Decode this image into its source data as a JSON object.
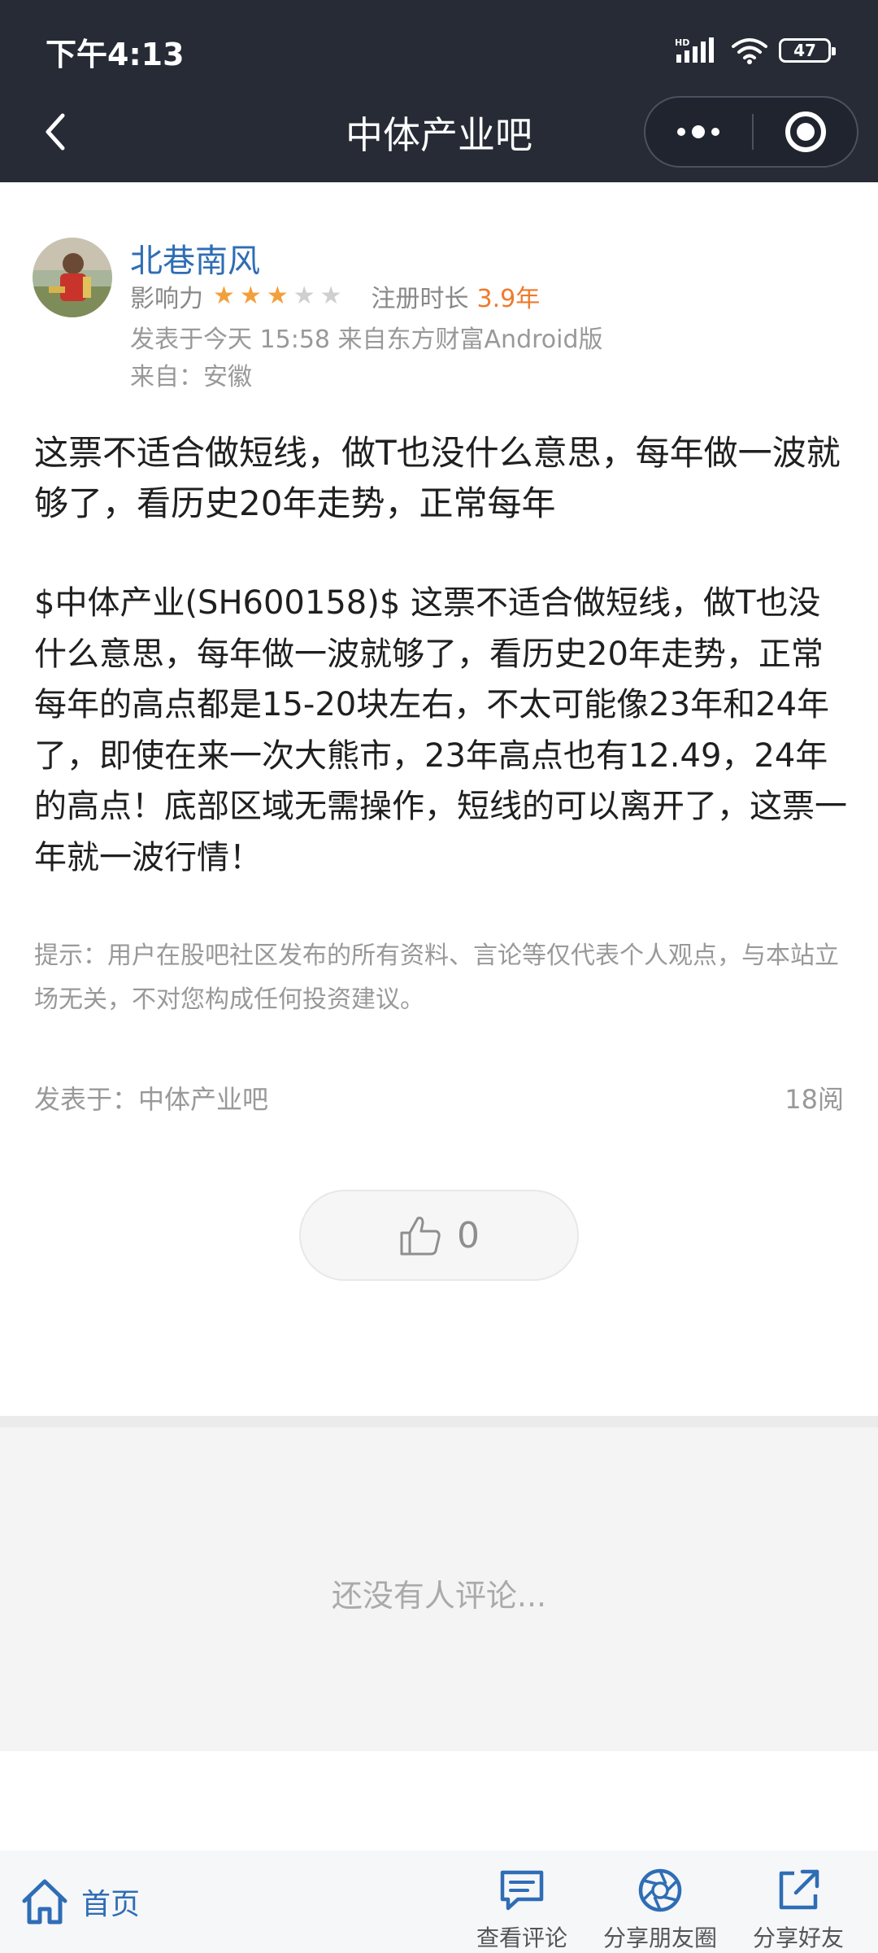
{
  "status_bar": {
    "time": "下午4:13",
    "battery": "47"
  },
  "nav": {
    "title": "中体产业吧"
  },
  "author": {
    "name": "北巷南风",
    "influence_label": "影响力",
    "influence_stars": 3,
    "influence_max_stars": 5,
    "register_label": "注册时长",
    "register_value": "3.9年",
    "post_time": "发表于今天 15:58 来自东方财富Android版",
    "location": "来自：安徽"
  },
  "post": {
    "title": "这票不适合做短线，做T也没什么意思，每年做一波就够了，看历史20年走势，正常每年",
    "body": "$中体产业(SH600158)$ 这票不适合做短线，做T也没什么意思，每年做一波就够了，看历史20年走势，正常每年的高点都是15-20块左右，不太可能像23年和24年了，即使在来一次大熊市，23年高点也有12.49，24年的高点！底部区域无需操作，短线的可以离开了，这票一年就一波行情！",
    "tip": "提示：用户在股吧社区发布的所有资料、言论等仅代表个人观点，与本站立场无关，不对您构成任何投资建议。",
    "posted_in": "发表于：中体产业吧",
    "read_count": "18阅",
    "like_count": "0"
  },
  "comments": {
    "empty_text": "还没有人评论..."
  },
  "bottom_bar": {
    "home_label": "首页",
    "view_comments_label": "查看评论",
    "share_moments_label": "分享朋友圈",
    "share_friend_label": "分享好友"
  },
  "colors": {
    "header_bg": "#262b36",
    "link_blue": "#2f6db5",
    "star_active": "#f2a03b",
    "register_value": "#f07a2c"
  }
}
